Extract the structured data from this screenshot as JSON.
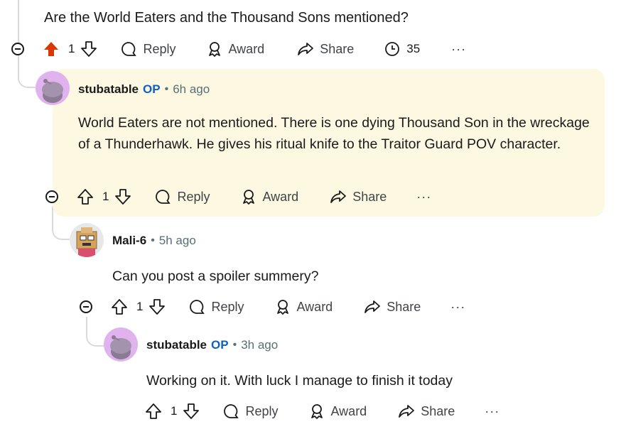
{
  "top_comment": {
    "text": "Are the World Eaters and the Thousand Sons mentioned?",
    "votes": "1",
    "reply_label": "Reply",
    "award_label": "Award",
    "share_label": "Share",
    "awards_count": "35",
    "more": "···",
    "upvoted": true,
    "upvote_color": "#d93900"
  },
  "comments": [
    {
      "username": "stubatable",
      "op_label": "OP",
      "time": "6h ago",
      "text": "World Eaters are not mentioned. There is one dying Thousand Son in the wreckage of a Thunderhawk. He gives his ritual knife to the Traitor Guard POV character.",
      "votes": "1",
      "reply_label": "Reply",
      "award_label": "Award",
      "share_label": "Share",
      "more": "···",
      "highlighted": true,
      "highlight_color": "#fdf8e1"
    },
    {
      "username": "Mali-6",
      "time": "5h ago",
      "text": "Can you post a spoiler summery?",
      "votes": "1",
      "reply_label": "Reply",
      "award_label": "Award",
      "share_label": "Share",
      "more": "···"
    },
    {
      "username": "stubatable",
      "op_label": "OP",
      "time": "3h ago",
      "text": "Working on it. With luck I manage to finish it today",
      "votes": "1",
      "reply_label": "Reply",
      "award_label": "Award",
      "share_label": "Share",
      "more": "···"
    }
  ],
  "colors": {
    "op": "#0f5fc5",
    "avatar_bg": "#e0b3ee",
    "thread_line": "#d9dadc"
  }
}
